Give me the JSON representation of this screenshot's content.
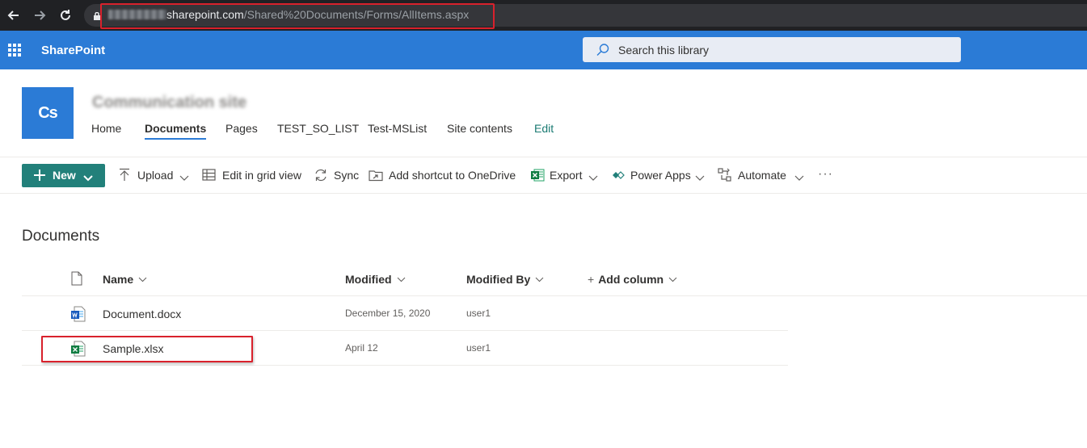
{
  "browser": {
    "url_domain": "sharepoint.com",
    "url_path": "/Shared%20Documents/Forms/AllItems.aspx",
    "icons": [
      "back-icon",
      "forward-icon",
      "reload-icon",
      "lock-icon"
    ]
  },
  "suite_bar": {
    "brand": "SharePoint",
    "search_placeholder": "Search this library",
    "color": "#2b7bd6"
  },
  "site": {
    "logo_text": "Cs",
    "title": "Communication site",
    "nav": [
      {
        "label": "Home"
      },
      {
        "label": "Documents",
        "active": true
      },
      {
        "label": "Pages"
      },
      {
        "label": "TEST_SO_LIST"
      },
      {
        "label": "Test-MSList"
      },
      {
        "label": "Site contents"
      },
      {
        "label": "Edit"
      }
    ]
  },
  "command_bar": {
    "new_label": "New",
    "upload_label": "Upload",
    "grid_label": "Edit in grid view",
    "sync_label": "Sync",
    "shortcut_label": "Add shortcut to OneDrive",
    "export_label": "Export",
    "powerapps_label": "Power Apps",
    "automate_label": "Automate",
    "more_label": "···",
    "accent": "#22807a"
  },
  "library": {
    "title": "Documents",
    "columns": {
      "name": "Name",
      "modified": "Modified",
      "modified_by": "Modified By",
      "add_column": "Add column"
    },
    "rows": [
      {
        "icon": "word-file-icon",
        "name": "Document.docx",
        "modified": "December 15, 2020",
        "modified_by": "user1"
      },
      {
        "icon": "excel-file-icon",
        "name": "Sample.xlsx",
        "modified": "April 12",
        "modified_by": "user1"
      }
    ]
  },
  "highlight_color": "#d9212c"
}
